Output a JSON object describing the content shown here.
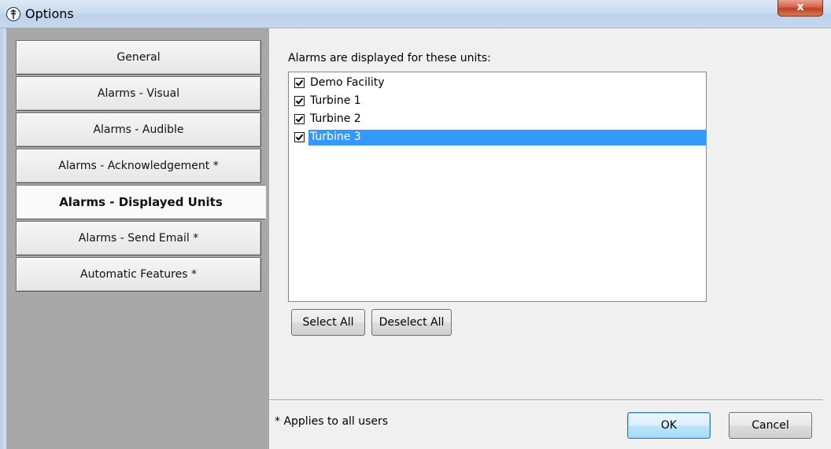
{
  "window": {
    "title": "Options",
    "close_label": "x"
  },
  "sidebar": {
    "items": [
      {
        "label": "General"
      },
      {
        "label": "Alarms - Visual"
      },
      {
        "label": "Alarms - Audible"
      },
      {
        "label": "Alarms - Acknowledgement *"
      },
      {
        "label": "Alarms - Displayed Units",
        "active": true
      },
      {
        "label": "Alarms - Send Email *"
      },
      {
        "label": "Automatic Features *"
      }
    ]
  },
  "main": {
    "units_label": "Alarms are displayed for these units:",
    "units": [
      {
        "label": "Demo Facility",
        "checked": true
      },
      {
        "label": "Turbine 1",
        "checked": true
      },
      {
        "label": "Turbine 2",
        "checked": true
      },
      {
        "label": "Turbine 3",
        "checked": true,
        "selected": true
      }
    ],
    "select_all_label": "Select All",
    "deselect_all_label": "Deselect All"
  },
  "footer": {
    "note": "* Applies to all users",
    "ok_label": "OK",
    "cancel_label": "Cancel"
  },
  "colors": {
    "selection": "#3399ff",
    "sidebar_bg": "#a8a8a8",
    "dialog_bg": "#f0f0f0"
  }
}
